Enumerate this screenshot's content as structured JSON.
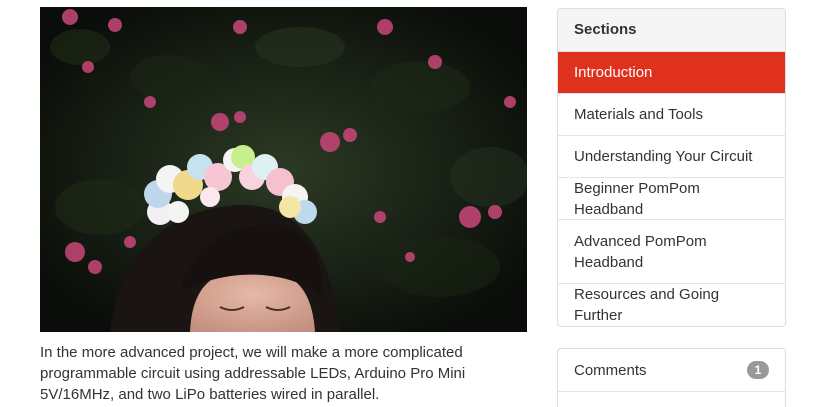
{
  "hero_image": {
    "subject": "girl-wearing-light-up-pompom-headband"
  },
  "intro": {
    "text": "In the more advanced project, we will make a more complicated programmable circuit using addressable LEDs, Arduino Pro Mini 5V/16MHz, and two LiPo batteries wired in parallel."
  },
  "sections": {
    "heading": "Sections",
    "items": [
      {
        "label": "Introduction"
      },
      {
        "label": "Materials and Tools"
      },
      {
        "label": "Understanding Your Circuit"
      },
      {
        "label": "Beginner PomPom Headband"
      },
      {
        "label": "Advanced PomPom Headband"
      },
      {
        "label": "Resources and Going Further"
      }
    ],
    "active_color": "#e0301e"
  },
  "comments": {
    "label": "Comments",
    "count": "1"
  }
}
